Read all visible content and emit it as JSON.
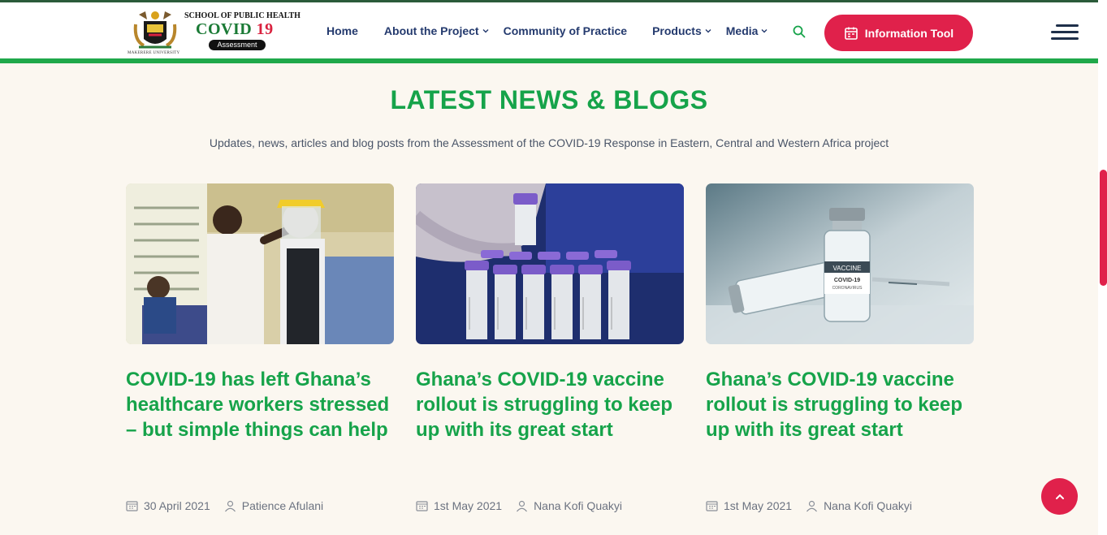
{
  "brand": {
    "school": "SCHOOL OF PUBLIC HEALTH",
    "covid_word": "COVID",
    "covid_num": "19",
    "tag": "Assessment",
    "university": "MAKERERE UNIVERSITY"
  },
  "nav": {
    "items": [
      {
        "label": "Home",
        "dropdown": false
      },
      {
        "label": "About the Project",
        "dropdown": true
      },
      {
        "label": "Community of Practice",
        "dropdown": false
      },
      {
        "label": "Products",
        "dropdown": true
      },
      {
        "label": "Media",
        "dropdown": true
      }
    ],
    "cta_label": "Information Tool"
  },
  "section": {
    "title": "LATEST NEWS & BLOGS",
    "subtitle": "Updates, news, articles and blog posts from the Assessment of the COVID-19 Response in Eastern, Central and Western Africa project"
  },
  "posts": [
    {
      "title": "COVID-19 has left Ghana’s healthcare workers stressed – but simple things can help",
      "date": "30 April 2021",
      "author": "Patience Afulani"
    },
    {
      "title": "Ghana’s COVID-19 vaccine rollout is struggling to keep up with its great start",
      "date": "1st May 2021",
      "author": "Nana Kofi Quakyi"
    },
    {
      "title": "Ghana’s COVID-19 vaccine rollout is struggling to keep up with its great start",
      "date": "1st May 2021",
      "author": "Nana Kofi Quakyi"
    }
  ],
  "images": {
    "vial_label_1": "VACCINE",
    "vial_label_2": "COVID-19",
    "vial_label_3": "CORONAVIRUS"
  },
  "colors": {
    "accent_green": "#16a34a",
    "accent_red": "#e0214b",
    "nav_blue": "#243a6e"
  }
}
